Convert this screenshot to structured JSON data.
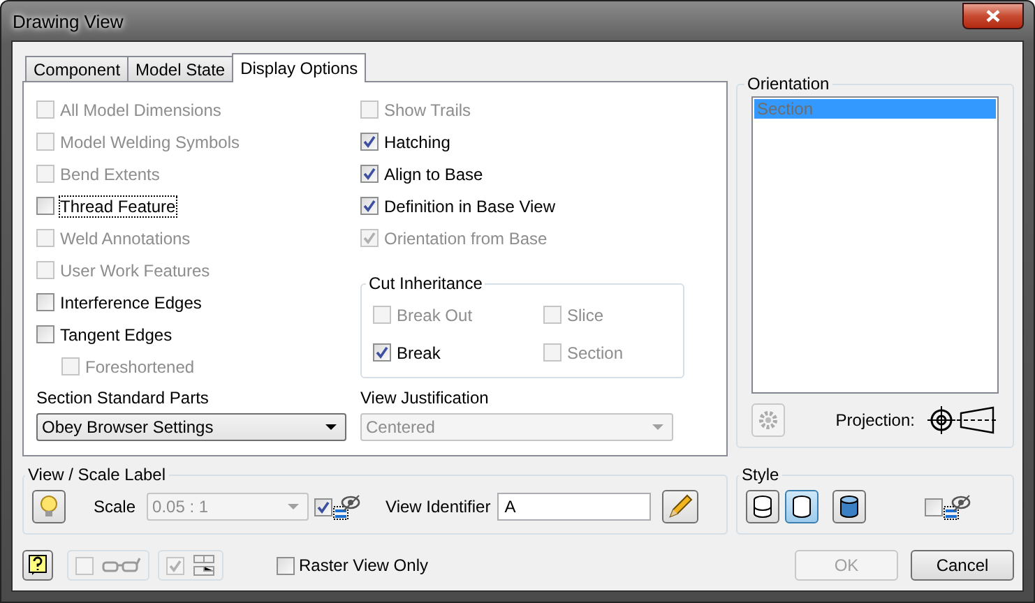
{
  "window": {
    "title": "Drawing View"
  },
  "tabs": [
    {
      "label": "Component",
      "selected": false
    },
    {
      "label": "Model State",
      "selected": false
    },
    {
      "label": "Display Options",
      "selected": true
    }
  ],
  "left_options": [
    {
      "label": "All Model Dimensions",
      "checked": false,
      "disabled": true,
      "focused": false
    },
    {
      "label": "Model Welding Symbols",
      "checked": false,
      "disabled": true,
      "focused": false
    },
    {
      "label": "Bend Extents",
      "checked": false,
      "disabled": true,
      "focused": false
    },
    {
      "label": "Thread Feature",
      "checked": false,
      "disabled": false,
      "focused": true
    },
    {
      "label": "Weld Annotations",
      "checked": false,
      "disabled": true,
      "focused": false
    },
    {
      "label": "User Work Features",
      "checked": false,
      "disabled": true,
      "focused": false
    },
    {
      "label": "Interference Edges",
      "checked": false,
      "disabled": false,
      "focused": false
    },
    {
      "label": "Tangent Edges",
      "checked": false,
      "disabled": false,
      "focused": false,
      "children": [
        {
          "label": "Foreshortened",
          "checked": false,
          "disabled": true,
          "focused": false
        }
      ]
    }
  ],
  "right_options": [
    {
      "label": "Show Trails",
      "checked": false,
      "disabled": true
    },
    {
      "label": "Hatching",
      "checked": true,
      "disabled": false
    },
    {
      "label": "Align to Base",
      "checked": true,
      "disabled": false
    },
    {
      "label": "Definition in Base View",
      "checked": true,
      "disabled": false
    },
    {
      "label": "Orientation from Base",
      "checked": true,
      "disabled": true
    }
  ],
  "cut_inheritance": {
    "title": "Cut Inheritance",
    "options": [
      {
        "label": "Break Out",
        "checked": false,
        "disabled": true
      },
      {
        "label": "Slice",
        "checked": false,
        "disabled": true
      },
      {
        "label": "Break",
        "checked": true,
        "disabled": false
      },
      {
        "label": "Section",
        "checked": false,
        "disabled": true
      }
    ]
  },
  "section_standard_parts": {
    "label": "Section Standard Parts",
    "value": "Obey Browser Settings",
    "disabled": false
  },
  "view_justification": {
    "label": "View Justification",
    "value": "Centered",
    "disabled": true
  },
  "orientation": {
    "title": "Orientation",
    "items": [
      {
        "label": "Section",
        "selected": true
      }
    ],
    "projection_label": "Projection:"
  },
  "view_scale_label": {
    "title": "View / Scale Label",
    "scale_label": "Scale",
    "scale_value": "0.05 : 1",
    "scale_disabled": true,
    "label_visible": true,
    "view_identifier_label": "View Identifier",
    "view_identifier_value": "A"
  },
  "style": {
    "title": "Style",
    "buttons": [
      {
        "kind": "hidden-lines",
        "selected": false
      },
      {
        "kind": "removed-lines",
        "selected": true
      },
      {
        "kind": "shaded",
        "selected": false
      }
    ],
    "label_visible": false
  },
  "bottom": {
    "glasses_checked": false,
    "layout_checked": true,
    "raster_label": "Raster View Only",
    "raster_checked": false
  },
  "buttons": [
    {
      "label": "OK",
      "disabled": true
    },
    {
      "label": "Cancel",
      "disabled": false
    }
  ]
}
